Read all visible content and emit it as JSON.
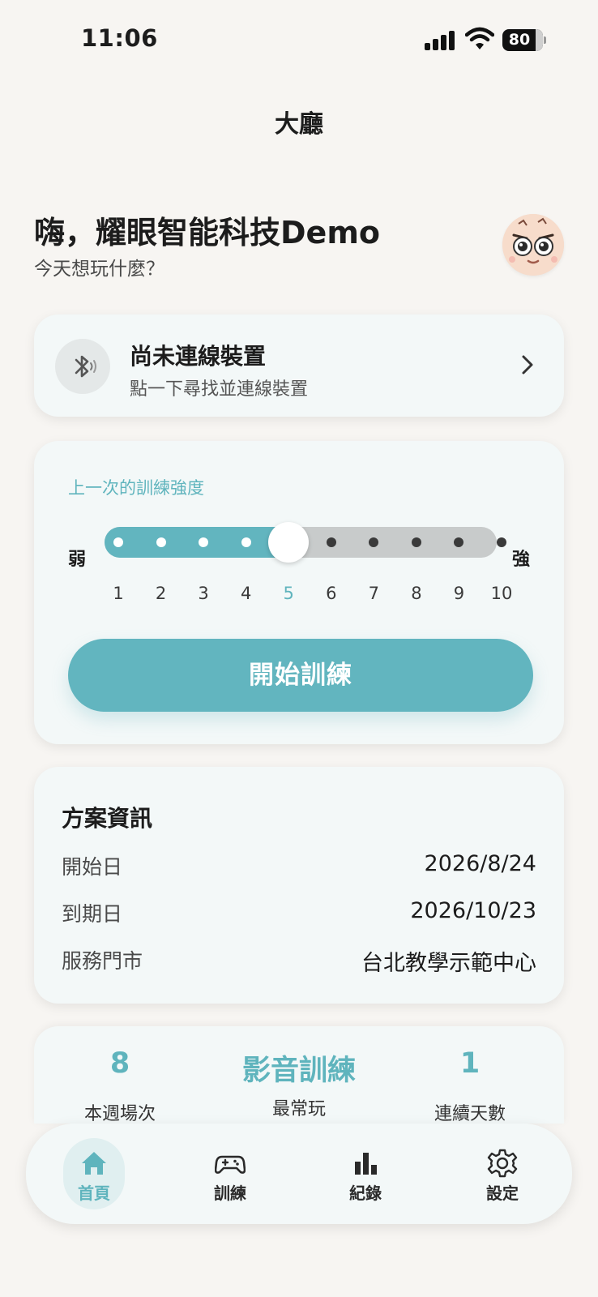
{
  "status_bar": {
    "time": "11:06",
    "battery": "80"
  },
  "header": {
    "title": "大廳"
  },
  "greeting": {
    "title": "嗨，耀眼智能科技Demo",
    "subtitle": "今天想玩什麼？"
  },
  "device": {
    "title": "尚未連線裝置",
    "subtitle": "點一下尋找並連線裝置",
    "icon": "bluetooth-icon"
  },
  "training": {
    "label": "上一次的訓練強度",
    "weak": "弱",
    "strong": "強",
    "level": 5,
    "max_level": 10,
    "ticks": [
      "1",
      "2",
      "3",
      "4",
      "5",
      "6",
      "7",
      "8",
      "9",
      "10"
    ],
    "start_button": "開始訓練"
  },
  "plan": {
    "title": "方案資訊",
    "rows": [
      {
        "key": "開始日",
        "value": "2026/8/24"
      },
      {
        "key": "到期日",
        "value": "2026/10/23"
      },
      {
        "key": "服務門市",
        "value": "台北教學示範中心"
      }
    ]
  },
  "stats": [
    {
      "value": "8",
      "label": "本週場次"
    },
    {
      "value": "影音訓練",
      "label": "最常玩"
    },
    {
      "value": "1",
      "label": "連續天數"
    }
  ],
  "tabs": [
    {
      "label": "首頁",
      "icon": "home-icon",
      "active": true
    },
    {
      "label": "訓練",
      "icon": "gamepad-icon",
      "active": false
    },
    {
      "label": "紀錄",
      "icon": "bar-chart-icon",
      "active": false
    },
    {
      "label": "設定",
      "icon": "gear-icon",
      "active": false
    }
  ],
  "colors": {
    "accent": "#62b5bf",
    "background": "#f7f5f2",
    "card": "#f3f8f8",
    "track_inactive": "#c8cbcb"
  }
}
